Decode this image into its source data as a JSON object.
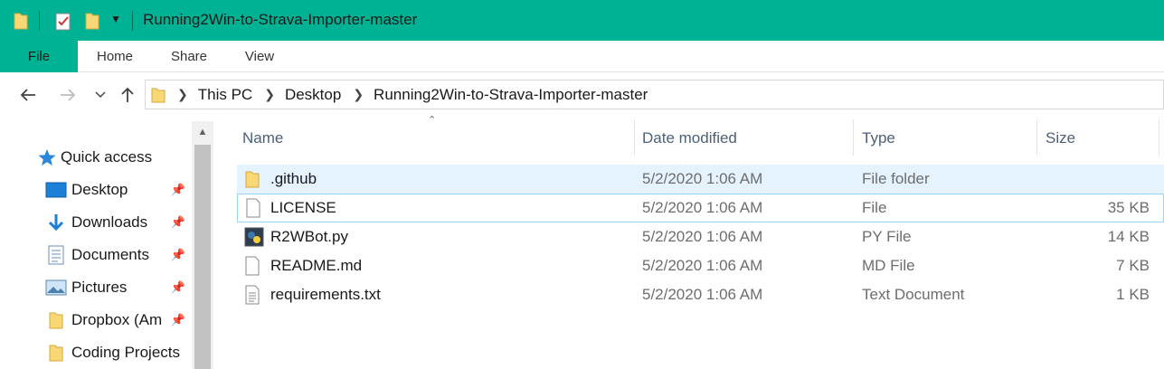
{
  "colors": {
    "accent": "#00b294",
    "selected_row": "#e5f3ff",
    "focus_border": "#99d1ff"
  },
  "window": {
    "title": "Running2Win-to-Strava-Importer-master",
    "quick_access_icons": [
      "folder-icon",
      "properties-icon",
      "new-folder-icon",
      "customize-dropdown-icon"
    ]
  },
  "ribbon": {
    "tabs": [
      {
        "label": "File"
      },
      {
        "label": "Home"
      },
      {
        "label": "Share"
      },
      {
        "label": "View"
      }
    ]
  },
  "navigation": {
    "back": "back-arrow-icon",
    "forward": "forward-arrow-icon",
    "recent": "recent-locations-icon",
    "up": "up-arrow-icon"
  },
  "breadcrumb": [
    "This PC",
    "Desktop",
    "Running2Win-to-Strava-Importer-master"
  ],
  "sidebar": {
    "quick_access": {
      "label": "Quick access",
      "icon": "star-icon"
    },
    "items": [
      {
        "label": "Desktop",
        "icon": "desktop-icon",
        "pinned": true
      },
      {
        "label": "Downloads",
        "icon": "download-icon",
        "pinned": true
      },
      {
        "label": "Documents",
        "icon": "documents-icon",
        "pinned": true
      },
      {
        "label": "Pictures",
        "icon": "pictures-icon",
        "pinned": true
      },
      {
        "label": "Dropbox (Am",
        "icon": "folder-icon",
        "pinned": true
      },
      {
        "label": "Coding Projects",
        "icon": "folder-icon",
        "pinned": false
      }
    ]
  },
  "file_list": {
    "columns": {
      "name": "Name",
      "date": "Date modified",
      "type": "Type",
      "size": "Size"
    },
    "rows": [
      {
        "name": ".github",
        "date": "5/2/2020 1:06 AM",
        "type": "File folder",
        "size": "",
        "icon": "folder-icon"
      },
      {
        "name": "LICENSE",
        "date": "5/2/2020 1:06 AM",
        "type": "File",
        "size": "35 KB",
        "icon": "blank-file-icon"
      },
      {
        "name": "R2WBot.py",
        "date": "5/2/2020 1:06 AM",
        "type": "PY File",
        "size": "14 KB",
        "icon": "python-file-icon"
      },
      {
        "name": "README.md",
        "date": "5/2/2020 1:06 AM",
        "type": "MD File",
        "size": "7 KB",
        "icon": "blank-file-icon"
      },
      {
        "name": "requirements.txt",
        "date": "5/2/2020 1:06 AM",
        "type": "Text Document",
        "size": "1 KB",
        "icon": "text-file-icon"
      }
    ]
  }
}
